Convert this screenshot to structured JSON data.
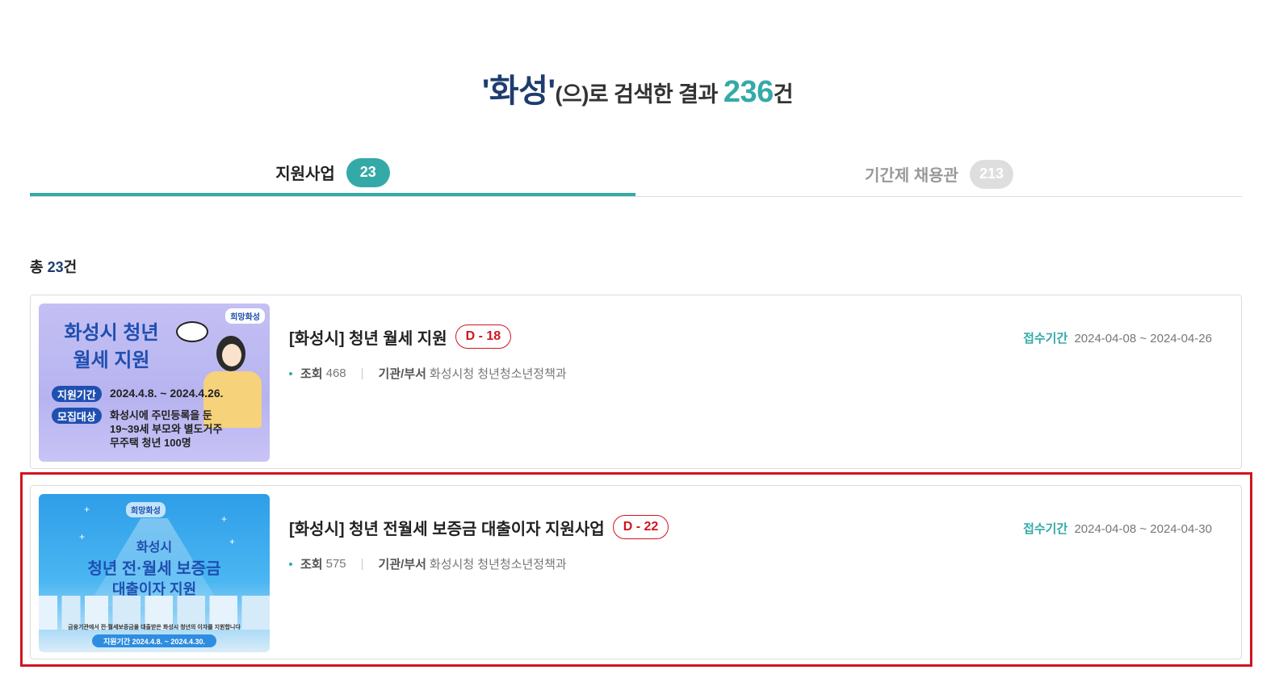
{
  "search": {
    "keyword": "'화성'",
    "suffix": "(으)로 검색한 결과",
    "count": "236",
    "unit": "건"
  },
  "tabs": [
    {
      "label": "지원사업",
      "count": "23",
      "active": true
    },
    {
      "label": "기간제 채용관",
      "count": "213",
      "active": false
    }
  ],
  "total": {
    "prefix": "총",
    "count": "23",
    "unit": "건"
  },
  "colors": {
    "accent": "#34aaa8",
    "navy": "#1e3d6e",
    "dday": "#d1141e",
    "highlight": "#d1141e"
  },
  "items": [
    {
      "title": "[화성시] 청년 월세 지원",
      "dday": "D - 18",
      "views_label": "조회",
      "views": "468",
      "dept_label": "기관/부서",
      "dept": "화성시청 청년청소년정책과",
      "period_label": "접수기간",
      "period": "2024-04-08 ~ 2024-04-26",
      "thumb": {
        "title_line1": "화성시 청년",
        "title_line2": "월세 지원",
        "logo": "희망화성",
        "pill1": "지원기간",
        "text1": "2024.4.8. ~ 2024.4.26.",
        "pill2": "모집대상",
        "text2_line1": "화성시에 주민등록을 둔",
        "text2_line2": "19~39세 부모와 별도거주",
        "text2_line3": "무주택 청년 100명"
      }
    },
    {
      "title": "[화성시] 청년 전월세 보증금 대출이자 지원사업",
      "dday": "D - 22",
      "views_label": "조회",
      "views": "575",
      "dept_label": "기관/부서",
      "dept": "화성시청 청년청소년정책과",
      "period_label": "접수기간",
      "period": "2024-04-08 ~ 2024-04-30",
      "thumb": {
        "logo": "희망화성",
        "line1": "화성시",
        "line2": "청년 전·월세 보증금",
        "line3": "대출이자 지원",
        "small": "금융기관에서 전·월세보증금을 대출받은 화성시 청년의 이자를 지원합니다",
        "pill": "지원기간 2024.4.8. ~ 2024.4.30."
      }
    }
  ]
}
